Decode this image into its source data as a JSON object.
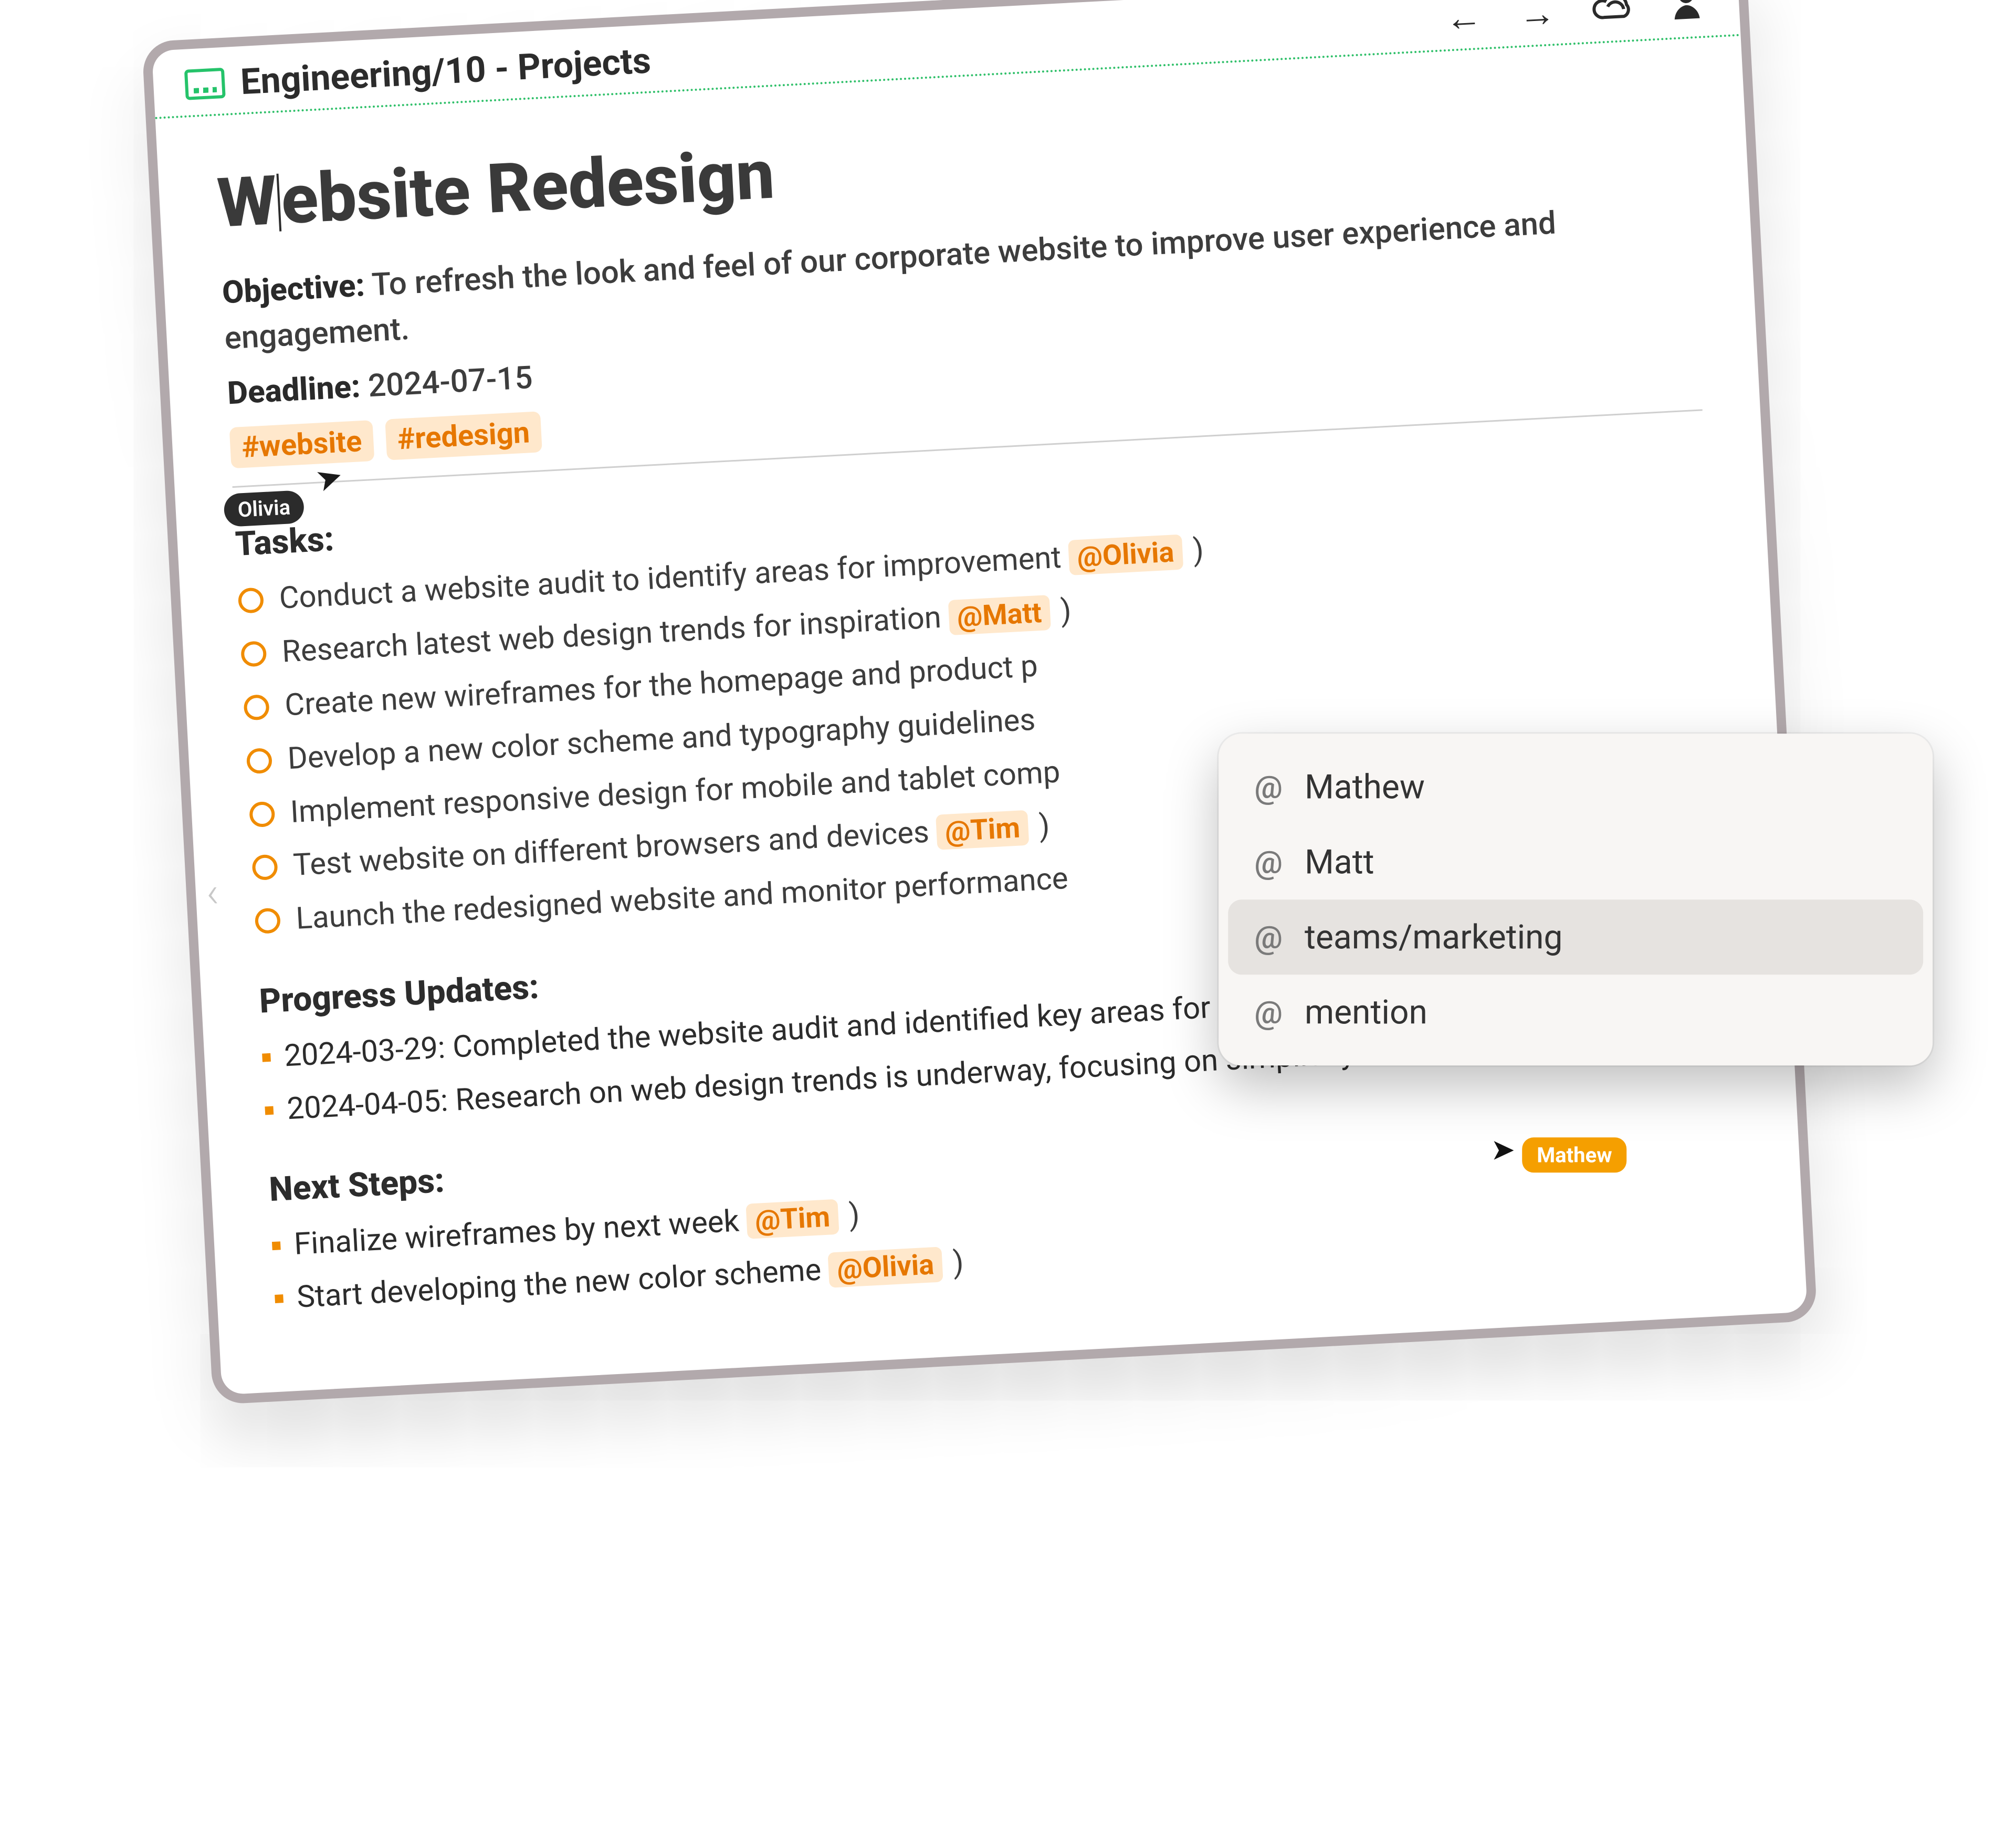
{
  "breadcrumb": "Engineering/10 - Projects",
  "title_pre": "W",
  "title_post": "ebsite Redesign",
  "objective_label": "Objective:",
  "objective_text": "To refresh the look and feel of our corporate website to improve user experience and engagement.",
  "deadline_label": "Deadline:",
  "deadline_value": "2024-07-15",
  "tags": [
    "#website",
    "#redesign"
  ],
  "presence_user": "Olivia",
  "tasks_heading": "Tasks:",
  "tasks": [
    {
      "text": "Conduct a website audit to identify areas for improvement",
      "mention": "@Olivia"
    },
    {
      "text": "Research latest web design trends for inspiration",
      "mention": "@Matt"
    },
    {
      "text": "Create new wireframes for the homepage and product p",
      "mention": ""
    },
    {
      "text": "Develop a new color scheme and typography guidelines",
      "mention": ""
    },
    {
      "text": "Implement responsive design for mobile and tablet comp",
      "mention": ""
    },
    {
      "text": "Test website on different browsers and devices",
      "mention": "@Tim"
    },
    {
      "text": "Launch the redesigned website and monitor performance",
      "mention": ""
    }
  ],
  "progress_heading": "Progress Updates:",
  "progress": [
    "2024-03-29: Completed the website audit and identified key areas for redesign.",
    "2024-04-05: Research on web design trends is underway, focusing on simplicity and user engagement."
  ],
  "next_heading": "Next Steps:",
  "next_steps": [
    {
      "text": "Finalize wireframes by next week",
      "mention": "@Tim"
    },
    {
      "text": "Start developing the new color scheme",
      "mention": "@Olivia"
    }
  ],
  "popup": {
    "items": [
      {
        "label": "Mathew",
        "selected": false
      },
      {
        "label": "Matt",
        "selected": false
      },
      {
        "label": "teams/marketing",
        "selected": true
      },
      {
        "label": "mention",
        "selected": false
      }
    ],
    "hover_badge": "Mathew"
  }
}
